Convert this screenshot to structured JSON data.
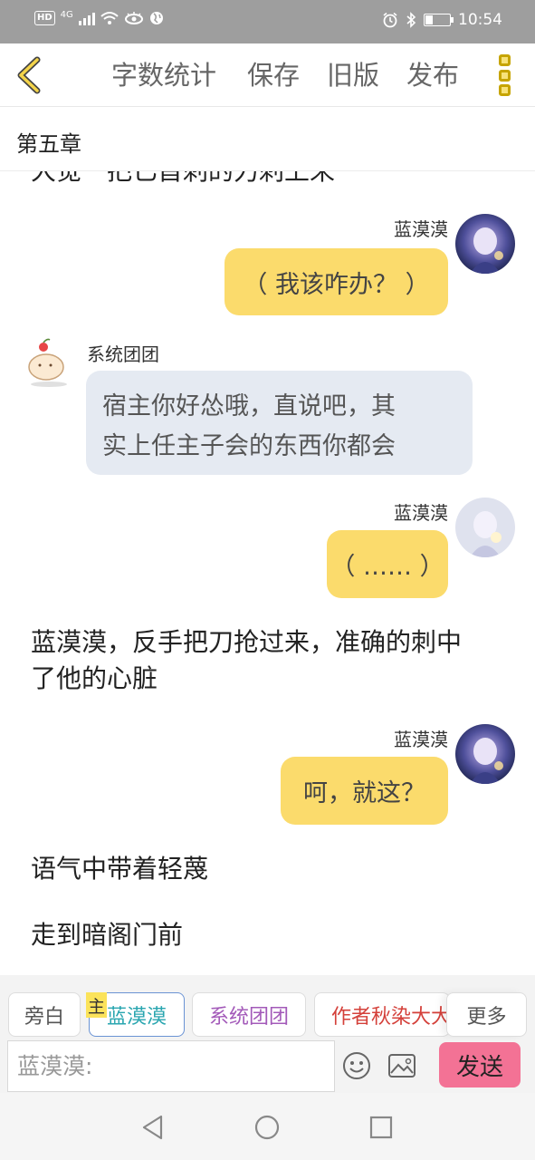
{
  "status_bar": {
    "network_label": "HD",
    "network_type": "4G",
    "time": "10:54"
  },
  "toolbar": {
    "word_count": "字数统计",
    "save": "保存",
    "old_version": "旧版",
    "publish": "发布"
  },
  "chapter": {
    "title": "第五章"
  },
  "content": {
    "cut_line": "大觉一把匕首刺的力刺上来",
    "messages": [
      {
        "sender": "蓝漠漠",
        "text": "（ 我该咋办？ ）"
      },
      {
        "sender": "系统团团",
        "lines": [
          "宿主你好怂哦，直说吧，其",
          "实上任主子会的东西你都会"
        ]
      },
      {
        "sender": "蓝漠漠",
        "text": "（ …… ）"
      },
      {
        "narration": [
          "蓝漠漠，反手把刀抢过来，准确的刺中",
          "了他的心脏"
        ]
      },
      {
        "sender": "蓝漠漠",
        "text": "呵，就这？"
      },
      {
        "narration": [
          "语气中带着轻蔑"
        ]
      },
      {
        "narration": [
          "走到暗阁门前"
        ]
      }
    ]
  },
  "roles": {
    "narrator": "旁白",
    "main_badge": "主",
    "lan": "蓝漠漠",
    "system": "系统团团",
    "author": "作者秋染大大",
    "more": "更多"
  },
  "input": {
    "placeholder": "蓝漠漠:",
    "send": "发送"
  },
  "colors": {
    "user_bubble": "#fbdb6c",
    "system_bubble": "#e5eaf2",
    "send_button": "#f37295",
    "accent_icon": "#c6a400"
  }
}
